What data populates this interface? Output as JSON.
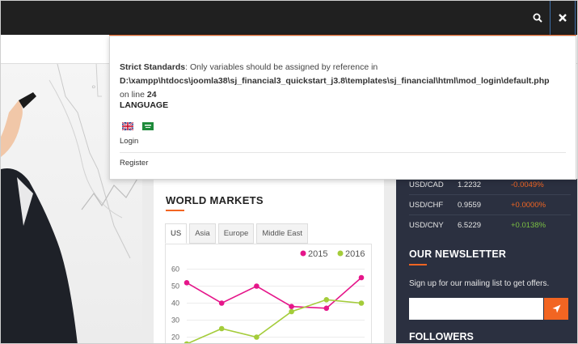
{
  "popup": {
    "error_label": "Strict Standards",
    "error_text": ": Only variables should be assigned by reference in",
    "error_path": "D:\\xampp\\htdocs\\joomla38\\sj_financial3_quickstart_j3.8\\templates\\sj_financial\\html\\mod_login\\default.php",
    "error_line_prefix": "on line ",
    "error_line": "24",
    "language_heading": "LANGUAGE",
    "login_label": "Login",
    "register_label": "Register",
    "flags": [
      "english-uk-flag",
      "arabic-flag"
    ]
  },
  "markets": {
    "title": "WORLD MARKETS",
    "tabs": [
      "US",
      "Asia",
      "Europe",
      "Middle East"
    ],
    "active_tab": "US"
  },
  "chart_data": {
    "type": "line",
    "x": [
      1,
      2,
      3,
      4,
      5,
      6
    ],
    "series": [
      {
        "name": "2015",
        "color": "#e5168a",
        "values": [
          52,
          40,
          50,
          38,
          37,
          55
        ]
      },
      {
        "name": "2016",
        "color": "#a4cc3a",
        "values": [
          16,
          25,
          20,
          35,
          42,
          40
        ]
      }
    ],
    "yticks": [
      20,
      30,
      40,
      50,
      60
    ],
    "ylim": [
      15,
      65
    ]
  },
  "currencies": [
    {
      "pair": "USD/CAD",
      "value": "1.2232",
      "change": "-0.0049%",
      "dir": "neg"
    },
    {
      "pair": "USD/CHF",
      "value": "0.9559",
      "change": "+0.0000%",
      "dir": "neg"
    },
    {
      "pair": "USD/CNY",
      "value": "6.5229",
      "change": "+0.0138%",
      "dir": "pos"
    }
  ],
  "newsletter": {
    "title": "OUR NEWSLETTER",
    "text": "Sign up for our mailing list to get offers.",
    "input_placeholder": ""
  },
  "followers": {
    "title": "FOLLOWERS"
  },
  "icons": {
    "search": "search-icon",
    "close": "close-icon",
    "send": "send-icon"
  },
  "colors": {
    "accent": "#f26522",
    "dark": "#202020",
    "panel": "#2b3040"
  }
}
